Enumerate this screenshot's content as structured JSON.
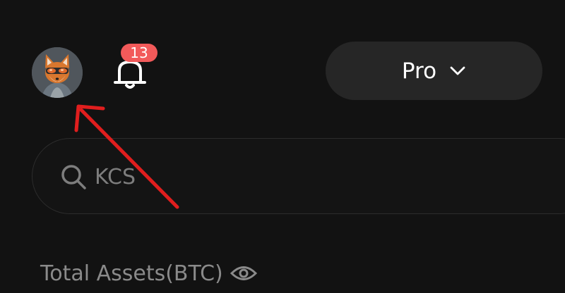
{
  "header": {
    "avatar_icon": "fox-avatar-icon",
    "bell_icon": "bell-icon",
    "notification_count": "13",
    "badge_color": "#f25a5a",
    "mode_selector": {
      "label": "Pro",
      "icon": "chevron-down-icon"
    }
  },
  "search": {
    "icon": "search-icon",
    "value": "KCS"
  },
  "assets": {
    "label": "Total Assets(BTC)",
    "visibility_icon": "eye-icon"
  },
  "annotation": {
    "type": "arrow",
    "color": "#e01e1e",
    "points_to": "avatar"
  }
}
